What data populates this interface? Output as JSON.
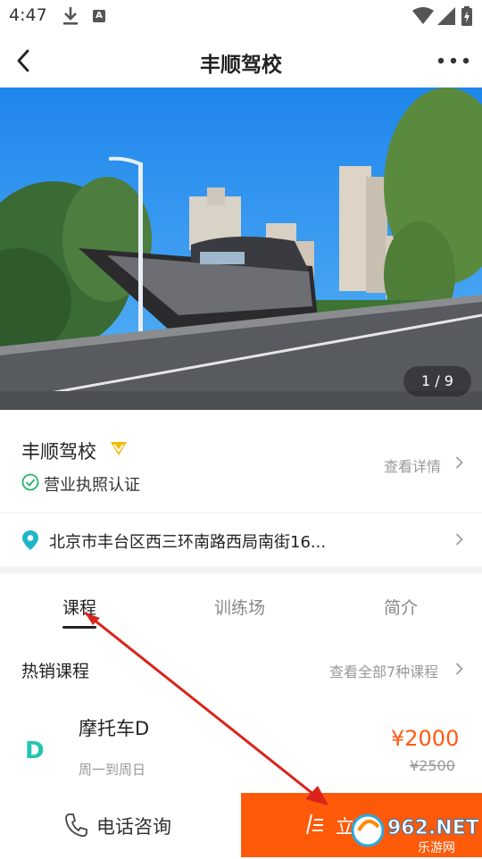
{
  "status_bar": {
    "time": "4:47",
    "a_label": "A"
  },
  "nav": {
    "title": "丰顺驾校"
  },
  "gallery": {
    "counter": "1 / 9"
  },
  "school": {
    "name": "丰顺驾校",
    "license": "营业执照认证",
    "detail_link": "查看详情"
  },
  "address": {
    "text": "北京市丰台区西三环南路西局南街16..."
  },
  "tabs": [
    {
      "label": "课程",
      "active": true
    },
    {
      "label": "训练场",
      "active": false
    },
    {
      "label": "简介",
      "active": false
    }
  ],
  "hot_courses": {
    "title": "热销课程",
    "see_all": "查看全部7种课程"
  },
  "course": {
    "badge": "D",
    "name": "摩托车D",
    "schedule": "周一到周日",
    "price": "¥2000",
    "original_price": "¥2500"
  },
  "bottom_bar": {
    "call_label": "电话咨询",
    "signup_label": "立即"
  },
  "watermark": {
    "brand": "962.NET",
    "subtitle": "乐游网"
  },
  "colors": {
    "accent": "#ff5a0a",
    "price": "#ff5a14",
    "badge": "#21c5b0",
    "pin": "#1fb6c9",
    "vip": "#f5b800",
    "check": "#27b36b"
  }
}
